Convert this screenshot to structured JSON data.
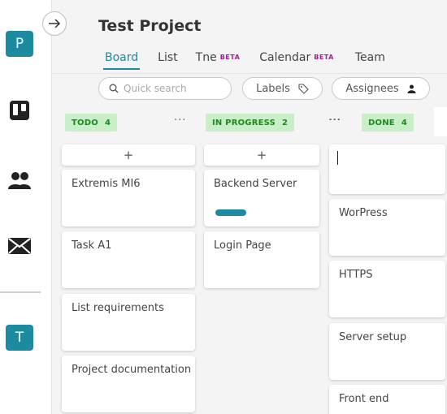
{
  "sidebar": {
    "workspaces": [
      {
        "letter": "P"
      },
      {
        "letter": "T"
      }
    ],
    "nav_icons": [
      "board-icon",
      "team-icon",
      "mail-icon"
    ],
    "collapse_icon": "arrow-right-icon"
  },
  "project": {
    "title": "Test Project"
  },
  "tabs": [
    {
      "label": "Board",
      "beta": "",
      "active": true
    },
    {
      "label": "List",
      "beta": "",
      "active": false
    },
    {
      "label": "Tne",
      "beta": "BETA",
      "active": false
    },
    {
      "label": "Calendar",
      "beta": "BETA",
      "active": false
    },
    {
      "label": "Team",
      "beta": "",
      "active": false
    }
  ],
  "filters": {
    "search_placeholder": "Quick search",
    "labels_label": "Labels",
    "assignees_label": "Assignees"
  },
  "board": {
    "add_glyph": "+",
    "more_glyph": "···",
    "columns": [
      {
        "name": "TODO",
        "count": "4",
        "cards": [
          "Extremis MI6",
          "Task A1",
          "List requirements",
          "Project documentation"
        ]
      },
      {
        "name": "IN PROGRESS",
        "count": "2",
        "cards": [
          "Backend Server",
          "Login Page"
        ]
      },
      {
        "name": "DONE",
        "count": "4",
        "new_card_value": "",
        "cards": [
          "WorPress",
          "HTTPS",
          "Server setup",
          "Front end"
        ]
      }
    ]
  },
  "colors": {
    "accent": "#1c8b9f",
    "beta": "#a21e95",
    "badge_bg": "#c8efc7",
    "badge_text": "#1d8a1d",
    "background": "#f4f4f4"
  }
}
